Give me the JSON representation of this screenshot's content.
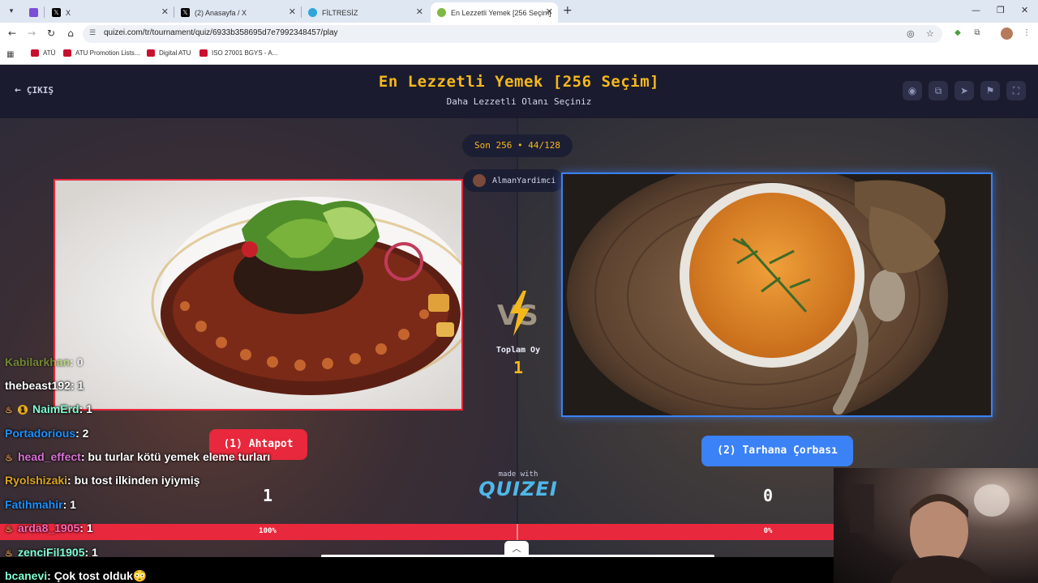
{
  "browser": {
    "tabs": [
      {
        "title": "",
        "icon": "app-icon",
        "color": "#7b4fd6"
      },
      {
        "title": "X",
        "icon": "x-logo-icon",
        "color": "#000000"
      },
      {
        "title": "(2) Anasayfa / X",
        "icon": "x-logo-icon",
        "color": "#000000"
      },
      {
        "title": "FİLTRESİZ",
        "icon": "telegram-icon",
        "color": "#2ea6da"
      },
      {
        "title": "En Lezzetli Yemek [256 Seçim]",
        "icon": "quizei-icon",
        "color": "#7fb843",
        "active": true
      }
    ],
    "url": "quizei.com/tr/tournament/quiz/6933b358695d7e7992348457/play",
    "bookmarks": [
      {
        "label": "ATÜ"
      },
      {
        "label": "ATU Promotion Lists..."
      },
      {
        "label": "Digital ATU"
      },
      {
        "label": "ISO 27001 BGYS - A..."
      }
    ]
  },
  "header": {
    "exit_label": "ÇIKIŞ",
    "title": "En Lezzetli Yemek [256 Seçim]",
    "subtitle": "Daha Lezzetli Olanı Seçiniz",
    "buttons": [
      "eye-icon",
      "share-icon",
      "send-icon",
      "flag-icon",
      "fullscreen-icon"
    ]
  },
  "round": {
    "label": "Son 256 • 44/128",
    "user": "AlmanYardimci"
  },
  "matchup": {
    "left": {
      "label": "(1) Ahtapot",
      "score": "1",
      "percent": "100%"
    },
    "right": {
      "label": "(2) Tarhana Çorbası",
      "score": "0",
      "percent": "0%"
    },
    "total_label": "Toplam Oy",
    "total_value": "1",
    "vote_share_left": 1.0
  },
  "footer": {
    "made_with": "made with",
    "logo": "QUIZEI"
  },
  "chat": [
    {
      "user": "Kabilarkhan",
      "text": ": 0",
      "color": "#9acd32",
      "badge": ""
    },
    {
      "user": "thebeast192",
      "text": ": 1",
      "color": "#ffffff",
      "badge": ""
    },
    {
      "user": "NaimErd",
      "text": ": 1",
      "color": "#7fffd4",
      "badge": "flame-badge-1"
    },
    {
      "user": "Portadorious",
      "text": ": 2",
      "color": "#1e90ff",
      "badge": ""
    },
    {
      "user": "head_effect",
      "text": ": bu turlar kötü yemek eleme turları",
      "color": "#da70d6",
      "badge": "flame"
    },
    {
      "user": "Ryolshizaki",
      "text": ": bu tost ilkinden iyiymiş",
      "color": "#daa520",
      "badge": ""
    },
    {
      "user": "Fatihmahir",
      "text": ": 1",
      "color": "#1e90ff",
      "badge": ""
    },
    {
      "user": "arda8_1905",
      "text": ": 1",
      "color": "#ff69b4",
      "badge": "flame"
    },
    {
      "user": "zenciFil1905",
      "text": ": 1",
      "color": "#7fffd4",
      "badge": "flame"
    },
    {
      "user": "bcanevi",
      "text": ": Çok tost olduk😳",
      "color": "#7fffd4",
      "badge": ""
    }
  ]
}
